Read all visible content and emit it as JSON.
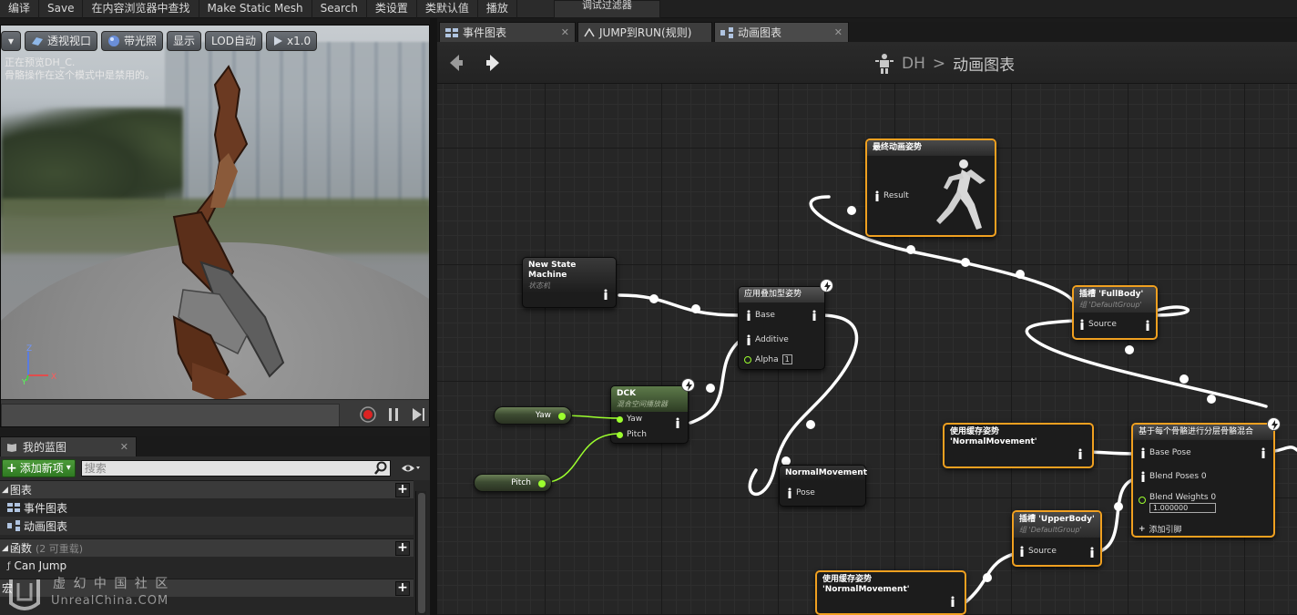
{
  "menubar": {
    "items": [
      "编译",
      "Save",
      "在内容浏览器中查找",
      "Make Static Mesh",
      "Search",
      "类设置",
      "类默认值",
      "播放"
    ],
    "filter": "调试过滤器"
  },
  "viewport": {
    "buttons": {
      "perspective": "透视视口",
      "lit": "带光照",
      "show": "显示",
      "lod": "LOD自动",
      "speed": "x1.0"
    },
    "overlay_line1": "正在预览DH_C.",
    "overlay_line2": "骨骼操作在这个模式中是禁用的。",
    "axis_z": "Z",
    "axis_y": "Y",
    "axis_x": "X"
  },
  "mybp": {
    "tab": "我的蓝图",
    "add_label": "添加新项",
    "search_placeholder": "搜索",
    "sections": {
      "graphs": {
        "label": "图表",
        "items": [
          "事件图表",
          "动画图表"
        ]
      },
      "functions": {
        "label": "函数",
        "count": "(2 可重载)",
        "items": [
          "Can Jump"
        ]
      },
      "macros": {
        "label": "宏"
      }
    }
  },
  "watermark": {
    "text": "虚 幻 中 国 社 区",
    "site": "UnrealChina.COM"
  },
  "graph": {
    "tabs": [
      "事件图表",
      "JUMP到RUN(规则)",
      "动画图表"
    ],
    "breadcrumb": {
      "root": "DH",
      "sep": ">",
      "current": "动画图表"
    },
    "nodes": {
      "final_pose": {
        "title": "最终动画姿势",
        "pin": "Result"
      },
      "state_machine": {
        "title": "New State Machine",
        "sub": "状态机"
      },
      "apply_additive": {
        "title": "应用叠加型姿势",
        "base": "Base",
        "additive": "Additive",
        "alpha": "Alpha",
        "alpha_value": "1"
      },
      "dck": {
        "title": "DCK",
        "sub": "混合空间播放器",
        "yaw": "Yaw",
        "pitch": "Pitch"
      },
      "yaw_var": "Yaw",
      "pitch_var": "Pitch",
      "normal_movement": {
        "title": "NormalMovement",
        "pin": "Pose"
      },
      "slot_fullbody": {
        "title": "插槽 'FullBody'",
        "sub": "组 'DefaultGroup'",
        "pin": "Source"
      },
      "cached_pose_1": {
        "title": "使用缓存姿势 'NormalMovement'"
      },
      "cached_pose_2": {
        "title": "使用缓存姿势 'NormalMovement'"
      },
      "layered_blend": {
        "title": "基于每个骨骼进行分层骨骼混合",
        "base_pose": "Base Pose",
        "blend_poses": "Blend Poses 0",
        "blend_weights": "Blend Weights 0",
        "weight_value": "1.000000",
        "add_pin": "添加引脚"
      },
      "slot_upperbody": {
        "title": "插槽 'UpperBody'",
        "sub": "组 'DefaultGroup'",
        "pin": "Source"
      }
    }
  },
  "colors": {
    "accent_selected": "#f0a020",
    "exec_green": "#9cff2e",
    "wire": "#ffffff"
  }
}
